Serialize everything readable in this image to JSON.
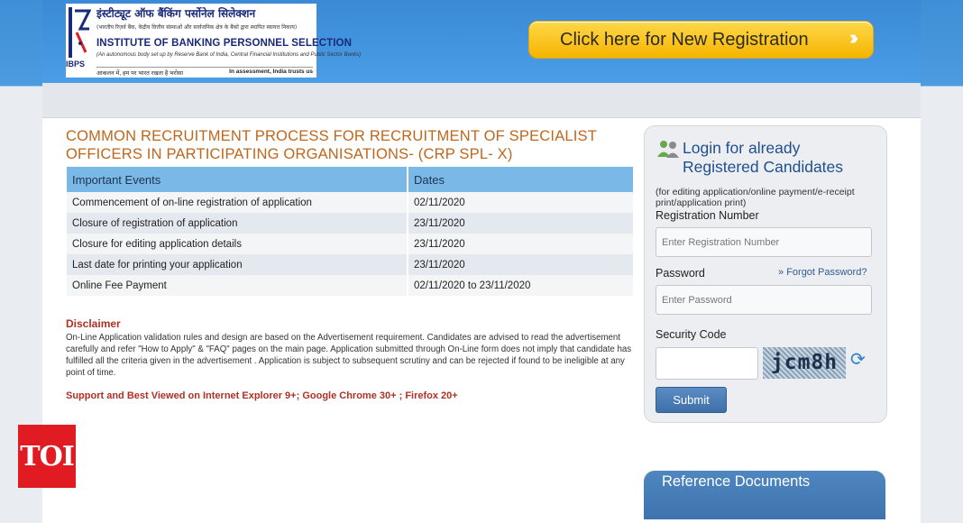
{
  "header": {
    "logo": {
      "hindi_name": "इंस्टीट्यूट ऑफ बैंकिंग पर्सोनेल सिलेक्शन",
      "hindi_tagline": "(भारतीय रिज़र्व बैंक, केंद्रीय वित्तीय संस्थाओं और सार्वजनिक क्षेत्र के बैंकों द्वारा स्थापित स्वायत्त निकाय)",
      "english_name": "INSTITUTE OF BANKING PERSONNEL SELECTION",
      "english_tagline": "(An autonomous body set up by Reserve Bank of India, Central Financial Institutions and Public Sector Banks)",
      "abbr": "IBPS",
      "motto_hi": "आकलन में, हम पर भारत रखता है भरोसा",
      "motto_en": "In assessment, India trusts us"
    },
    "new_registration_label": "Click here for New Registration"
  },
  "main": {
    "title": "COMMON RECRUITMENT PROCESS FOR RECRUITMENT OF SPECIALIST OFFICERS IN PARTICIPATING ORGANISATIONS- (CRP SPL- X)",
    "table": {
      "headers": [
        "Important Events",
        "Dates"
      ],
      "rows": [
        [
          "Commencement of on-line registration of application",
          "02/11/2020"
        ],
        [
          "Closure of registration of application",
          "23/11/2020"
        ],
        [
          "Closure for editing application details",
          "23/11/2020"
        ],
        [
          "Last date for printing your application",
          "23/11/2020"
        ],
        [
          "Online Fee Payment",
          "02/11/2020 to 23/11/2020"
        ]
      ]
    },
    "disclaimer_title": "Disclaimer",
    "disclaimer_text": "On-Line Application validation rules and design are based on the Advertisement requirement. Candidates are advised to read the advertisement carefully and refer \"How to Apply\" & \"FAQ\" pages on the main page. Application submitted through On-Line form does not imply that candidate has fulfilled all the criteria given in the advertisement . Application is subject to subsequent scrutiny and can be rejected if found to be ineligible at any point of time.",
    "support_text": "Support and Best Viewed on Internet Explorer 9+; Google Chrome 30+ ; Firefox 20+"
  },
  "login": {
    "title_line1": "Login for already",
    "title_line2": "Registered Candidates",
    "note": "(for editing application/online payment/e-receipt print/application print)",
    "reg_label": "Registration Number",
    "reg_placeholder": "Enter Registration Number",
    "password_label": "Password",
    "forgot_label": "Forgot Password?",
    "password_placeholder": "Enter Password",
    "security_label": "Security Code",
    "captcha_text": "jcm8h",
    "submit_label": "Submit"
  },
  "reference": {
    "title": "Reference Documents"
  },
  "watermark": {
    "label": "TOI",
    "color": "#e01b22"
  },
  "colors": {
    "header_blue": "#4a9de6",
    "title_orange": "#c0661a",
    "table_header": "#7ab8e8",
    "cta_yellow": "#f5b400",
    "disclaimer_red": "#b03025"
  }
}
